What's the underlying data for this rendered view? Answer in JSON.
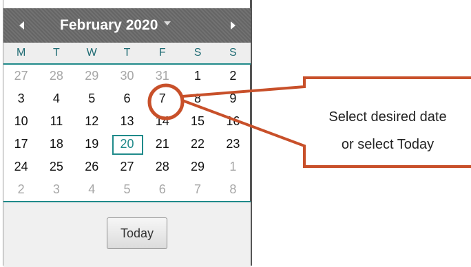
{
  "calendar": {
    "month_label": "February 2020",
    "prev_icon": "triangle-left-icon",
    "next_icon": "triangle-right-icon",
    "dropdown_icon": "triangle-down-icon",
    "weekdays": [
      "M",
      "T",
      "W",
      "T",
      "F",
      "S",
      "S"
    ],
    "weeks": [
      [
        {
          "d": "27",
          "other": true
        },
        {
          "d": "28",
          "other": true
        },
        {
          "d": "29",
          "other": true
        },
        {
          "d": "30",
          "other": true
        },
        {
          "d": "31",
          "other": true
        },
        {
          "d": "1"
        },
        {
          "d": "2"
        }
      ],
      [
        {
          "d": "3"
        },
        {
          "d": "4"
        },
        {
          "d": "5"
        },
        {
          "d": "6"
        },
        {
          "d": "7"
        },
        {
          "d": "8"
        },
        {
          "d": "9"
        }
      ],
      [
        {
          "d": "10"
        },
        {
          "d": "11"
        },
        {
          "d": "12"
        },
        {
          "d": "13"
        },
        {
          "d": "14"
        },
        {
          "d": "15"
        },
        {
          "d": "16"
        }
      ],
      [
        {
          "d": "17"
        },
        {
          "d": "18"
        },
        {
          "d": "19"
        },
        {
          "d": "20",
          "today": true
        },
        {
          "d": "21"
        },
        {
          "d": "22"
        },
        {
          "d": "23"
        }
      ],
      [
        {
          "d": "24"
        },
        {
          "d": "25"
        },
        {
          "d": "26"
        },
        {
          "d": "27"
        },
        {
          "d": "28"
        },
        {
          "d": "29"
        },
        {
          "d": "1",
          "other": true
        }
      ],
      [
        {
          "d": "2",
          "other": true
        },
        {
          "d": "3",
          "other": true
        },
        {
          "d": "4",
          "other": true
        },
        {
          "d": "5",
          "other": true
        },
        {
          "d": "6",
          "other": true
        },
        {
          "d": "7",
          "other": true
        },
        {
          "d": "8",
          "other": true
        }
      ]
    ],
    "today_button_label": "Today"
  },
  "callout": {
    "line1": "Select desired date",
    "line2": "or select Today",
    "highlighted_day": "7"
  },
  "colors": {
    "header": "#6a6a6a",
    "accent_teal": "#1f8a8a",
    "callout_red": "#c8502a"
  }
}
